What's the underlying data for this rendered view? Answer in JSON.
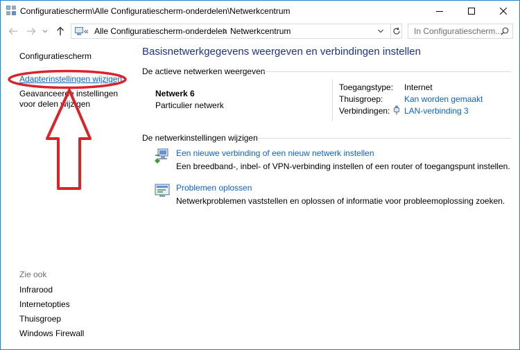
{
  "window": {
    "title": "Configuratiescherm\\Alle Configuratiescherm-onderdelen\\Netwerkcentrum"
  },
  "address": {
    "overflow_glyph": "«",
    "breadcrumbs": [
      "Alle Configuratiescherm-onderdelen",
      "Netwerkcentrum"
    ]
  },
  "search": {
    "placeholder": "In Configuratiescherm..."
  },
  "sidebar": {
    "home": "Configuratiescherm",
    "adapter": "Adapterinstellingen wijzigen",
    "advanced": "Geavanceerde instellingen voor delen wijzigen",
    "see_also_label": "Zie ook",
    "see_also": [
      "Infrarood",
      "Internetopties",
      "Thuisgroep",
      "Windows Firewall"
    ]
  },
  "main": {
    "title": "Basisnetwerkgegevens weergeven en verbindingen instellen",
    "active_header": "De actieve netwerken weergeven",
    "network_name": "Netwerk  6",
    "network_type": "Particulier netwerk",
    "access_label": "Toegangstype:",
    "access_value": "Internet",
    "homegroup_label": "Thuisgroep:",
    "homegroup_value": "Kan worden gemaakt",
    "connections_label": "Verbindingen:",
    "connections_value": "LAN-verbinding 3",
    "change_header": "De netwerkinstellingen wijzigen",
    "task1_link": "Een nieuwe verbinding of een nieuw netwerk instellen",
    "task1_desc": "Een breedband-, inbel- of VPN-verbinding instellen of een router of toegangspunt instellen.",
    "task2_link": "Problemen oplossen",
    "task2_desc": "Netwerkproblemen vaststellen en oplossen of informatie voor probleemoplossing zoeken."
  },
  "colors": {
    "link": "#0a62c9",
    "title": "#1e3287",
    "annotation": "#d9242b"
  },
  "icons": [
    "app-icon",
    "minimize-icon",
    "maximize-icon",
    "close-icon",
    "back-arrow-icon",
    "forward-arrow-icon",
    "recent-dropdown-icon",
    "up-arrow-icon",
    "computer-icon",
    "chevron-right-icon",
    "dropdown-icon",
    "refresh-icon",
    "search-icon",
    "ethernet-icon",
    "new-connection-icon",
    "troubleshoot-icon"
  ]
}
